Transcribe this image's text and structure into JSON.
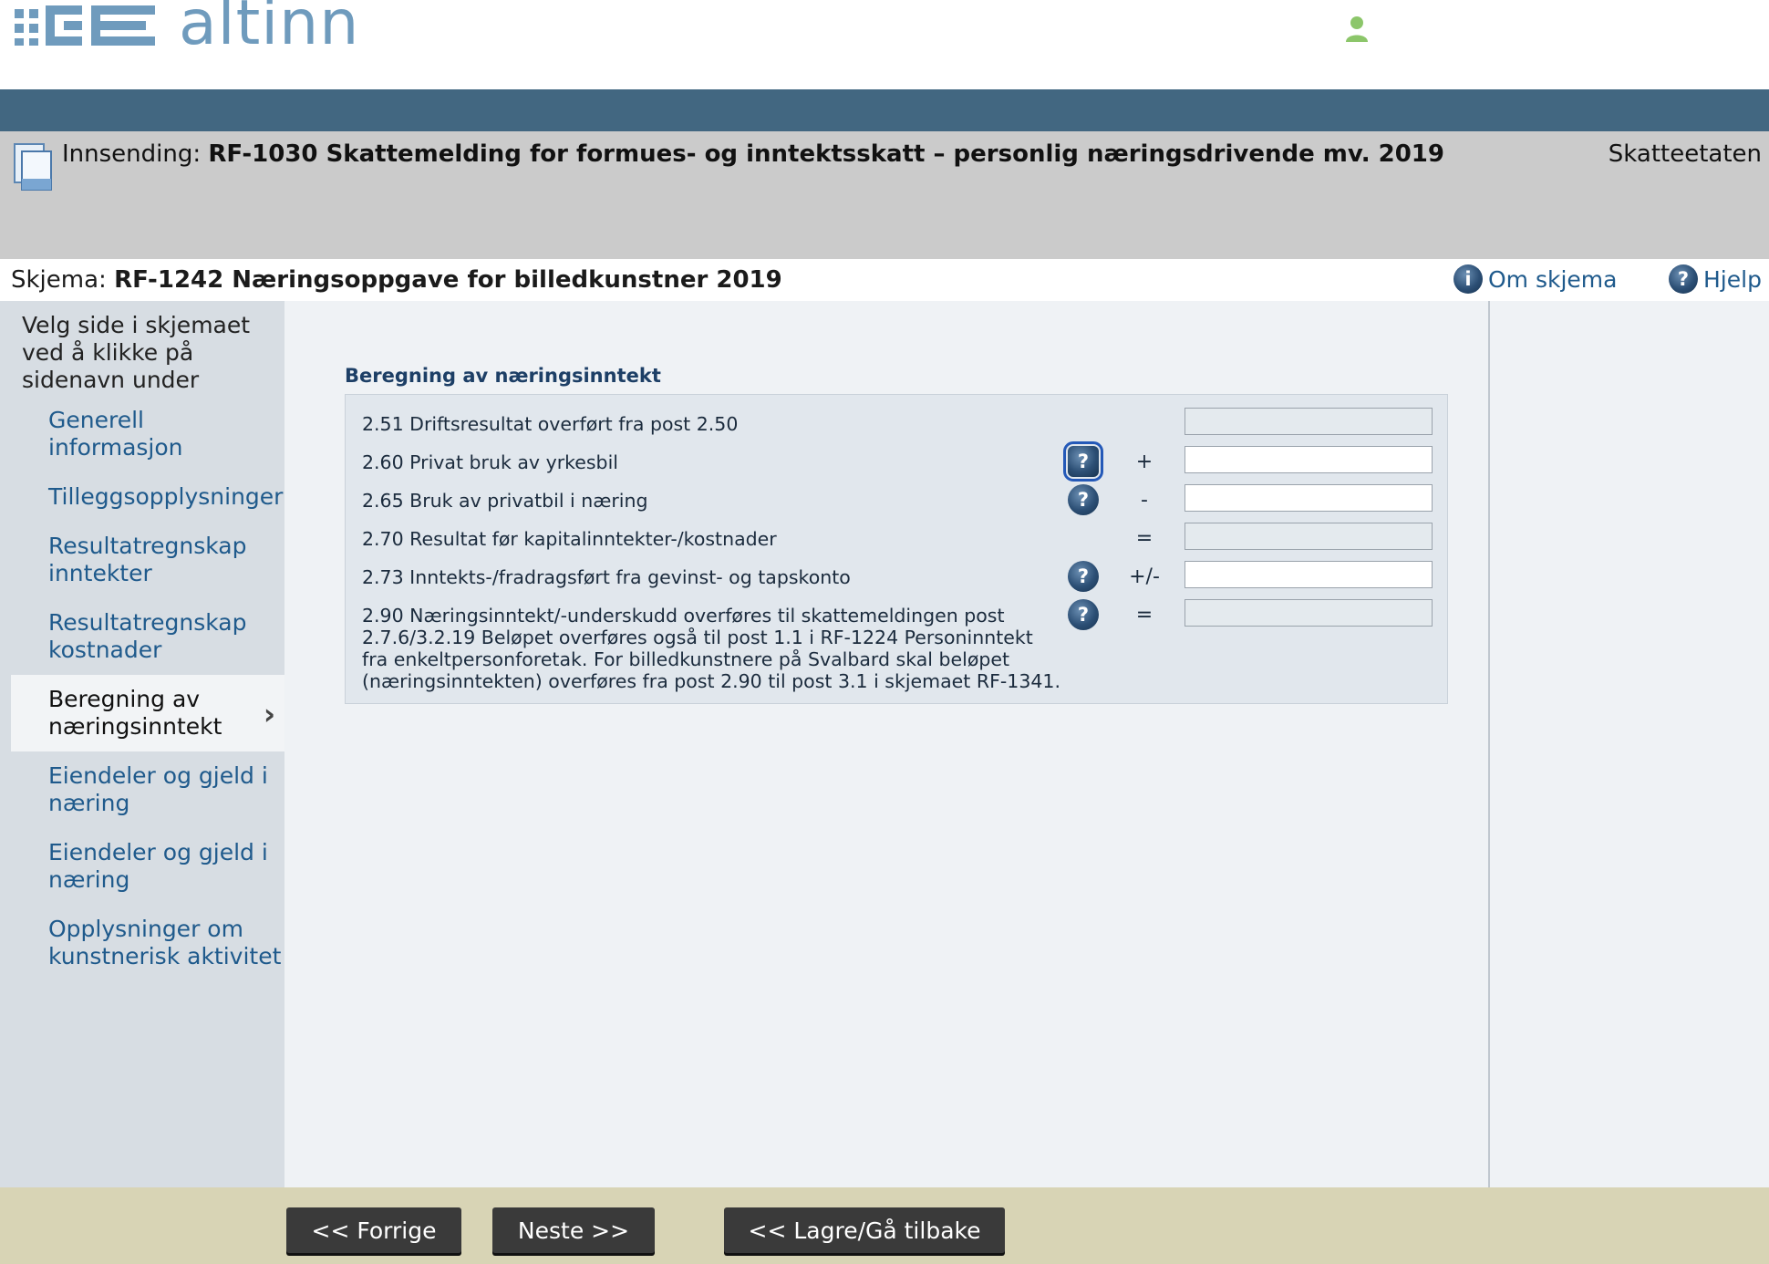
{
  "brand": {
    "logo_text": "altinn"
  },
  "header": {
    "submission_prefix": "Innsending:",
    "submission_title": "RF-1030 Skattemelding for formues- og inntektsskatt – personlig næringsdrivende mv. 2019",
    "agency": "Skatteetaten"
  },
  "schema": {
    "prefix": "Skjema:",
    "title": "RF-1242 Næringsoppgave for billedkunstner 2019",
    "about_label": "Om skjema",
    "help_label": "Hjelp"
  },
  "sidebar": {
    "intro": "Velg side i skjemaet ved å klikke på sidenavn under",
    "items": [
      {
        "label": "Generell informasjon"
      },
      {
        "label": "Tilleggsopplysninger"
      },
      {
        "label": "Resultatregnskap inntekter"
      },
      {
        "label": "Resultatregnskap kostnader"
      },
      {
        "label": "Beregning av næringsinntekt",
        "active": true
      },
      {
        "label": "Eiendeler og gjeld i næring"
      },
      {
        "label": "Eiendeler og gjeld i næring"
      },
      {
        "label": "Opplysninger om kunstnerisk aktivitet"
      }
    ]
  },
  "section": {
    "title": "Beregning av næringsinntekt",
    "rows": [
      {
        "label": "2.51 Driftsresultat overført fra post 2.50",
        "help": false,
        "op": "",
        "value": "",
        "readonly": true
      },
      {
        "label": "2.60 Privat bruk av yrkesbil",
        "help": true,
        "op": "+",
        "value": "",
        "readonly": false
      },
      {
        "label": "2.65 Bruk av privatbil i næring",
        "help": true,
        "op": "-",
        "value": "",
        "readonly": false
      },
      {
        "label": "2.70 Resultat før kapitalinntekter-/kostnader",
        "help": false,
        "op": "=",
        "value": "",
        "readonly": true
      },
      {
        "label": "2.73 Inntekts-/fradragsført fra gevinst- og tapskonto",
        "help": true,
        "op": "+/-",
        "value": "",
        "readonly": false
      },
      {
        "label": "2.90 Næringsinntekt/-underskudd overføres til skattemeldingen post 2.7.6/3.2.19 Beløpet overføres også til post 1.1 i RF-1224 Personinntekt fra enkeltpersonforetak. For billedkunstnere på Svalbard skal beløpet (næringsinntekten) overføres fra post 2.90 til post 3.1 i skjemaet RF-1341.",
        "help": true,
        "op": "=",
        "value": "",
        "readonly": true
      }
    ]
  },
  "footer": {
    "prev_label": "<< Forrige",
    "next_label": "Neste >>",
    "save_back_label": "<< Lagre/Gå tilbake"
  },
  "colors": {
    "header_bar": "#426781",
    "link": "#1f5a8c",
    "footer_bg": "#d8d4b5",
    "button_bg": "#3a3a3a"
  },
  "icons": {
    "user": "user-icon",
    "document": "document-icon",
    "info": "info-icon",
    "help": "help-icon",
    "chevron": "chevron-right-icon"
  }
}
